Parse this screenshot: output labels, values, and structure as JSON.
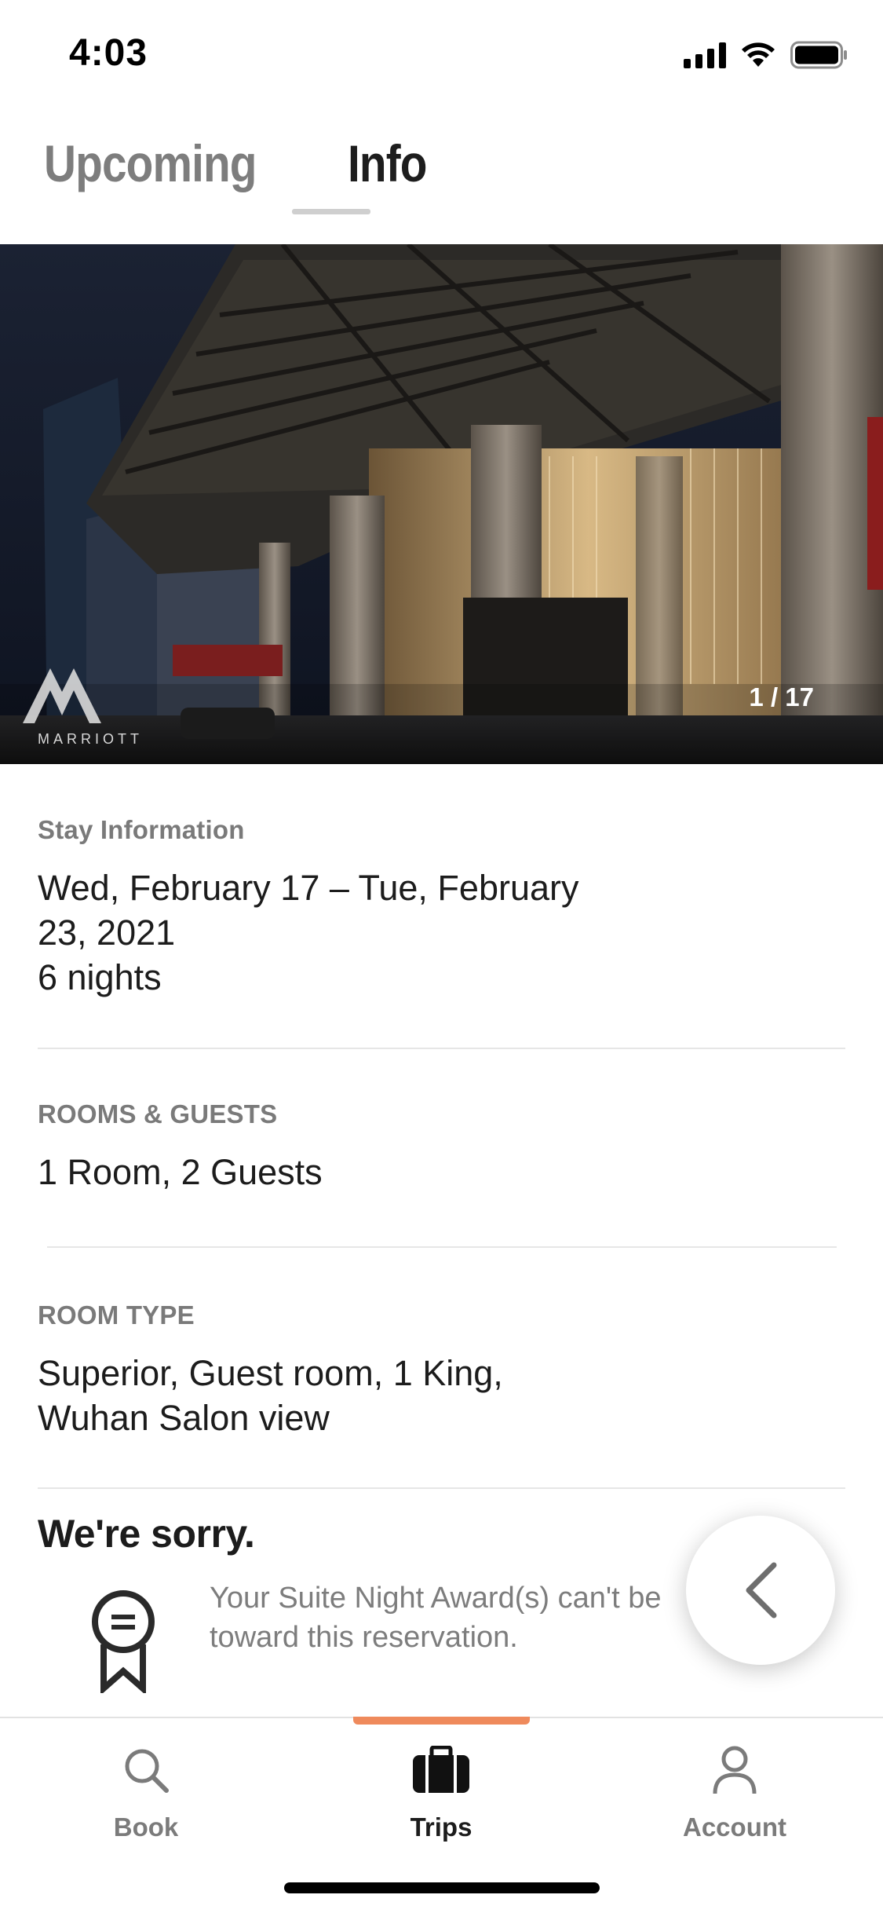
{
  "status_bar": {
    "time": "4:03"
  },
  "tabs": [
    {
      "label": "Upcoming",
      "active": false
    },
    {
      "label": "Info",
      "active": true
    }
  ],
  "hero": {
    "counter": "1 / 17",
    "brand": "MARRIOTT"
  },
  "stay_info": {
    "label": "Stay Information",
    "dates_line1": "Wed, February 17 – Tue, February",
    "dates_line2": "23, 2021",
    "nights": "6 nights"
  },
  "rooms_guests": {
    "label": "ROOMS & GUESTS",
    "value": "1 Room, 2 Guests"
  },
  "room_type": {
    "label": "ROOM TYPE",
    "line1": "Superior, Guest room, 1 King,",
    "line2": "Wuhan Salon view"
  },
  "notice": {
    "title": "We're sorry.",
    "line1": "Your Suite Night Award(s) can't be",
    "line2": "toward this reservation."
  },
  "bottom_nav": [
    {
      "label": "Book",
      "icon": "search-icon",
      "active": false
    },
    {
      "label": "Trips",
      "icon": "suitcase-icon",
      "active": true
    },
    {
      "label": "Account",
      "icon": "person-icon",
      "active": false
    }
  ],
  "colors": {
    "accent": "#ef8a5c",
    "label_gray": "#7a7a7a",
    "text": "#1c1c1c"
  }
}
